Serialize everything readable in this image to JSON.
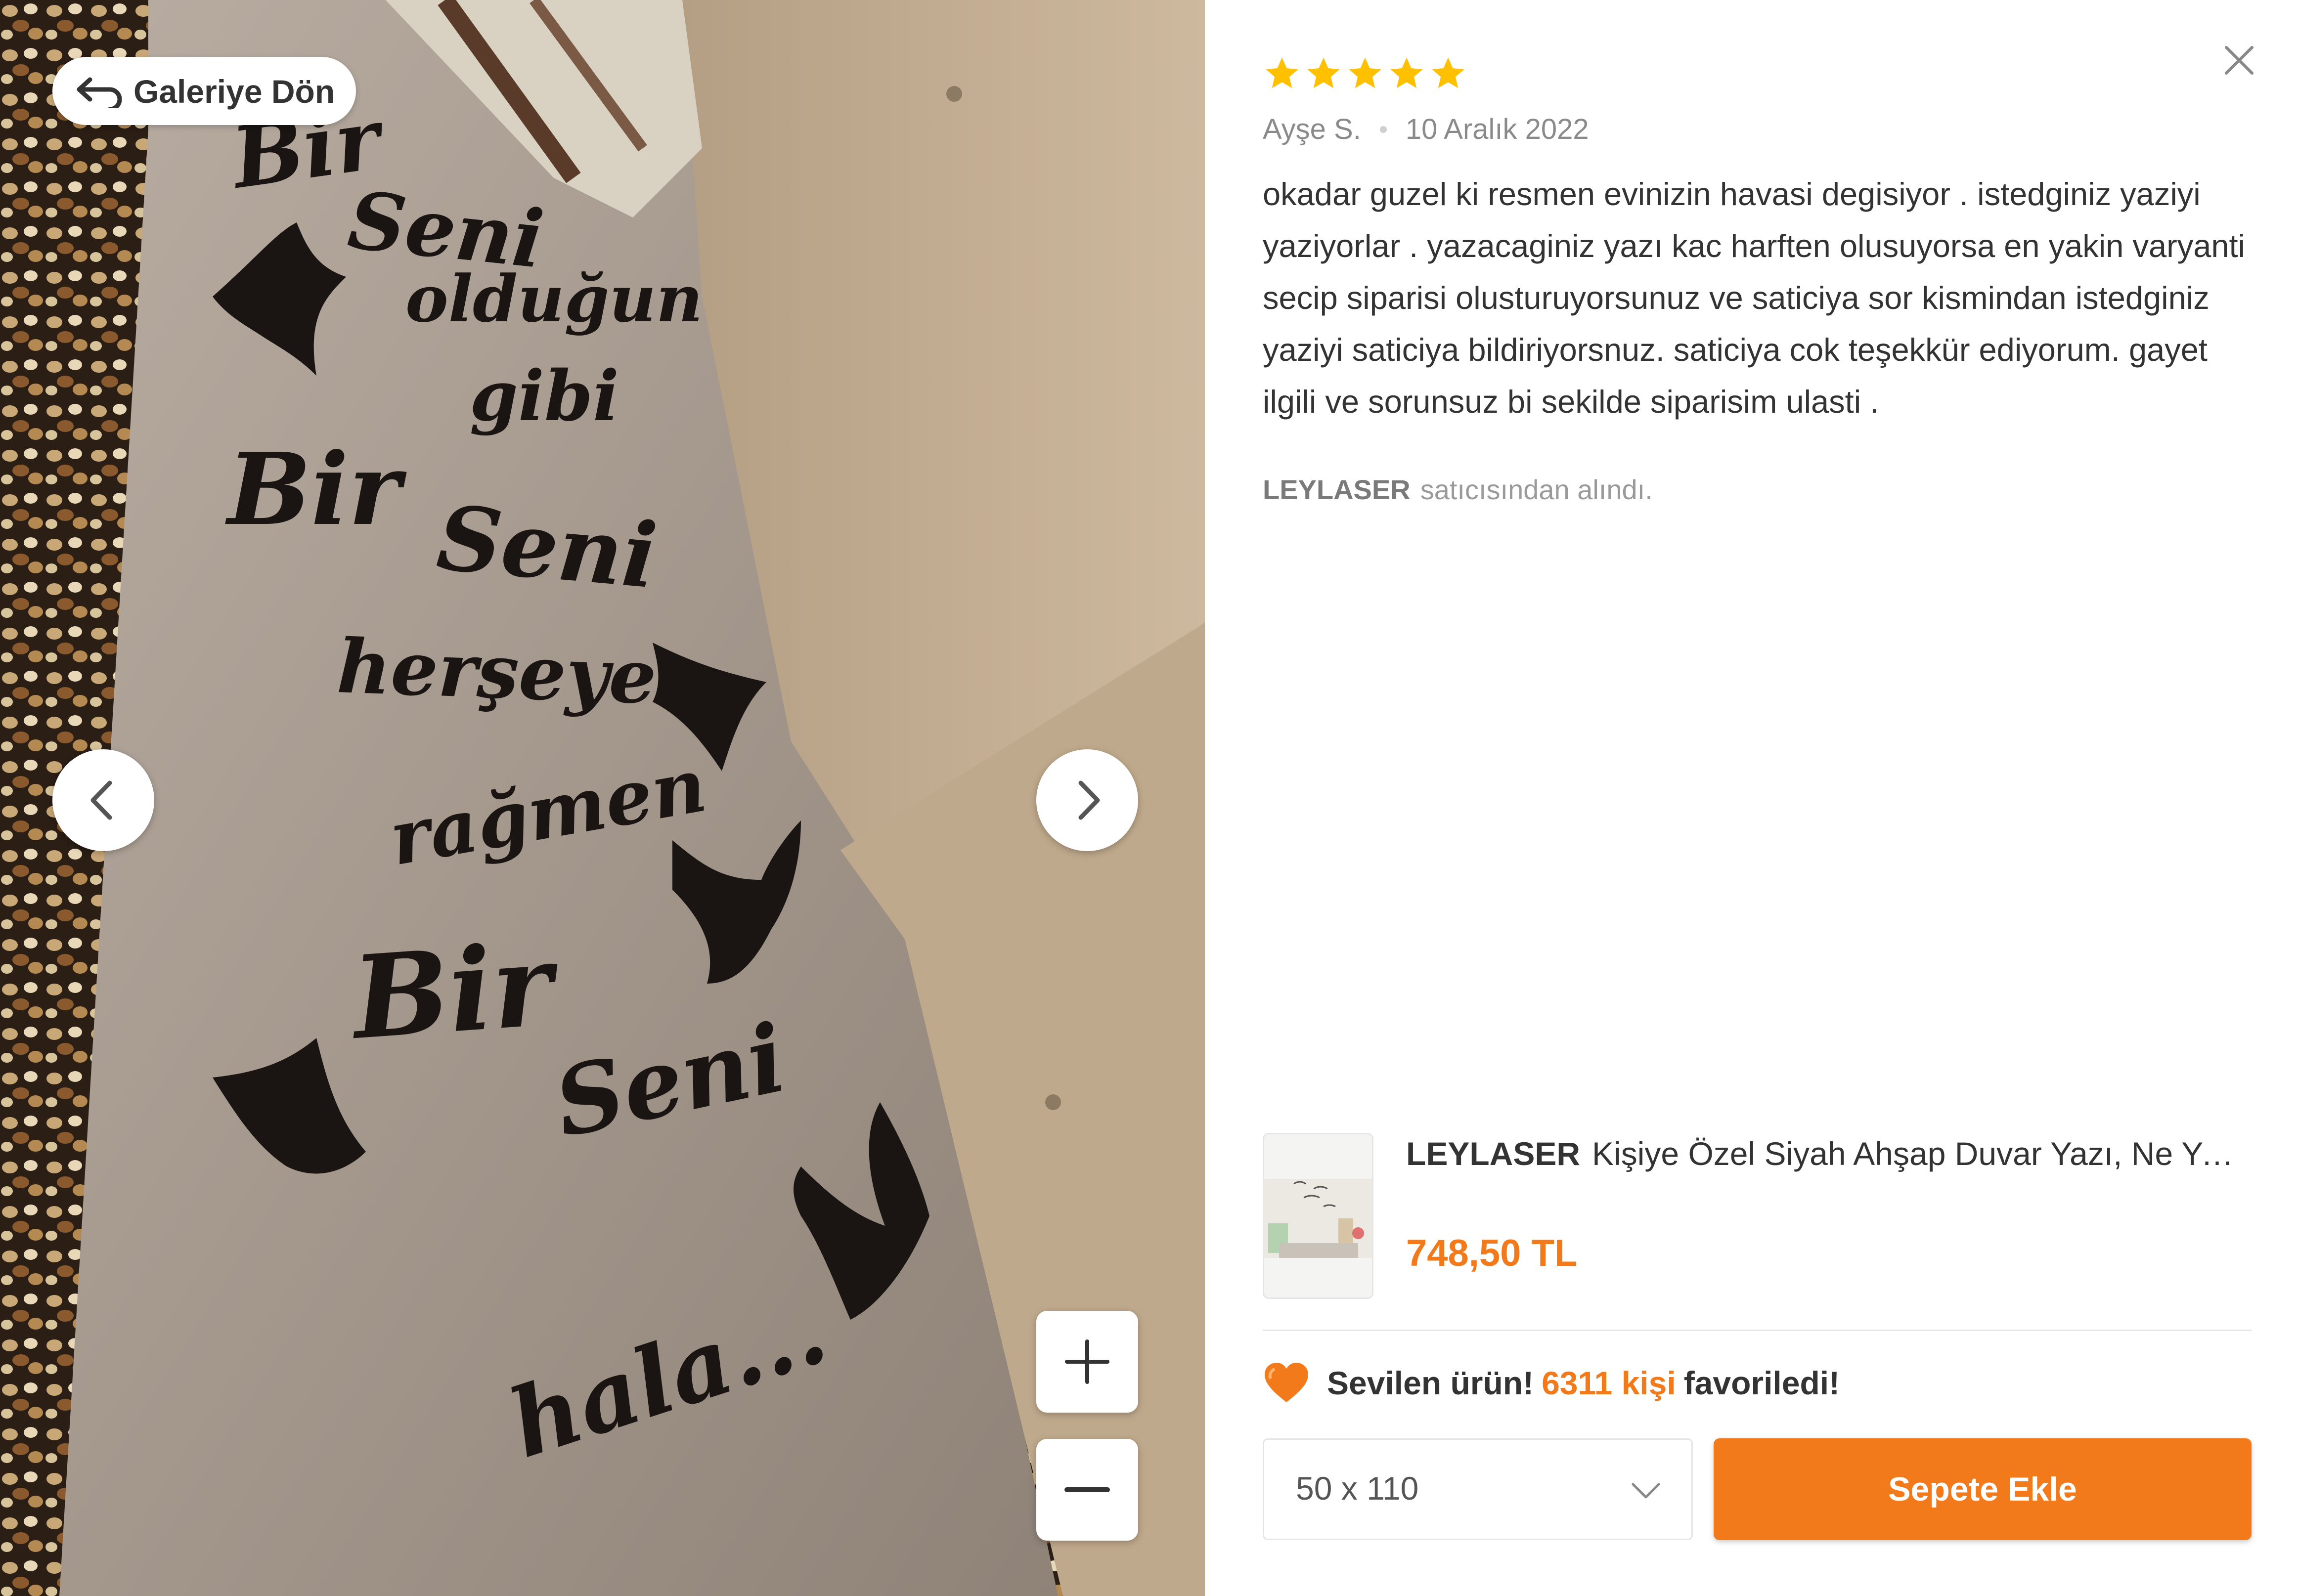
{
  "gallery": {
    "back_label": "Galeriye Dön",
    "photo_text": {
      "line1": "Bir",
      "line2": "Seni",
      "line3": "olduğun",
      "line4": "gibi",
      "line5": "Bir",
      "line6": "Seni",
      "line7": "herşeye",
      "line8": "rağmen",
      "line9": "Bir",
      "line10": "Seni",
      "line11": "hala..."
    }
  },
  "review": {
    "rating": 5,
    "author": "Ayşe S.",
    "date": "10 Aralık 2022",
    "text": "okadar guzel ki resmen evinizin havasi degisiyor . istedginiz yaziyi yaziyorlar . yazacaginiz yazı kac harften olusuyorsa en yakin varyanti secip siparisi olusturuyorsunuz ve saticiya sor kismindan istedginiz yaziyi saticiya bildiriyorsnuz. saticiya cok teşekkür ediyorum. gayet ilgili ve sorunsuz bi sekilde siparisim ulasti .",
    "seller_name": "LEYLASER",
    "seller_suffix": "satıcısından alındı."
  },
  "product": {
    "brand": "LEYLASER",
    "title": "Kişiye Özel Siyah Ahşap Duvar Yazı, Ne Yazılacağını Satıcıya Sor Kısmından Bildiriniz",
    "price": "748,50 TL"
  },
  "favorites": {
    "prefix": "Sevilen ürün!",
    "count": "6311 kişi",
    "suffix": "favoriledi!"
  },
  "purchase": {
    "selected_size": "50 x 110",
    "cart_label": "Sepete Ekle"
  },
  "colors": {
    "accent": "#f27a1a",
    "star": "#ffc000",
    "text": "#333333",
    "muted": "#8a8a8a"
  }
}
